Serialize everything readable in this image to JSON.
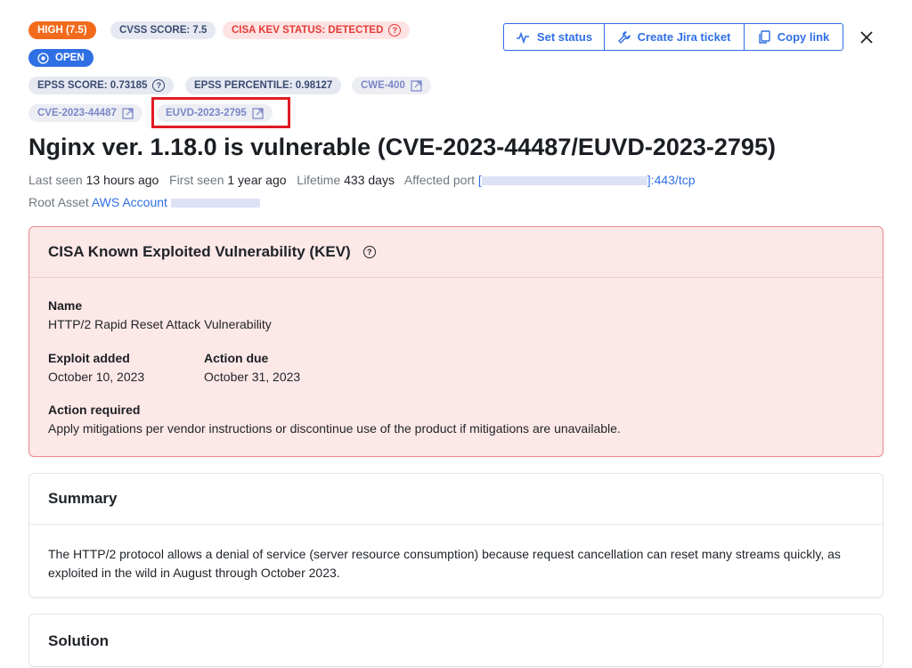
{
  "badges": {
    "severity": "HIGH (7.5)",
    "cvss": "CVSS SCORE: 7.5",
    "kev_status": "CISA KEV STATUS: DETECTED",
    "status": "OPEN",
    "epss_score": "EPSS SCORE: 0.73185",
    "epss_percentile": "EPSS PERCENTILE: 0.98127",
    "cwe": "CWE-400",
    "cve": "CVE-2023-44487",
    "euvd": "EUVD-2023-2795"
  },
  "toolbar": {
    "set_status": "Set status",
    "create_jira": "Create Jira ticket",
    "copy_link": "Copy link"
  },
  "title": "Nginx ver. 1.18.0 is vulnerable (CVE-2023-44487/EUVD-2023-2795)",
  "meta": {
    "last_seen_label": "Last seen",
    "last_seen": "13 hours ago",
    "first_seen_label": "First seen",
    "first_seen": "1 year ago",
    "lifetime_label": "Lifetime",
    "lifetime": "433 days",
    "affected_port_label": "Affected port",
    "affected_port_prefix": "[",
    "affected_port_suffix": "]:443/tcp",
    "root_asset_label": "Root Asset",
    "root_asset": "AWS Account"
  },
  "kev": {
    "heading": "CISA Known Exploited Vulnerability (KEV)",
    "name_label": "Name",
    "name": "HTTP/2 Rapid Reset Attack Vulnerability",
    "exploit_added_label": "Exploit added",
    "exploit_added": "October 10, 2023",
    "action_due_label": "Action due",
    "action_due": "October 31, 2023",
    "action_required_label": "Action required",
    "action_required": "Apply mitigations per vendor instructions or discontinue use of the product if mitigations are unavailable."
  },
  "summary": {
    "heading": "Summary",
    "text": "The HTTP/2 protocol allows a denial of service (server resource consumption) because request cancellation can reset many streams quickly, as exploited in the wild in August through October 2023."
  },
  "solution": {
    "heading": "Solution"
  },
  "icons": {
    "question": "question-circle-icon",
    "external": "external-link-icon",
    "close": "close-icon"
  },
  "colors": {
    "accent": "#2f6fe4",
    "high": "#f26b1d",
    "kev_red": "#e53a35",
    "kev_bg": "#fde8e8",
    "highlight": "#e01b24"
  }
}
